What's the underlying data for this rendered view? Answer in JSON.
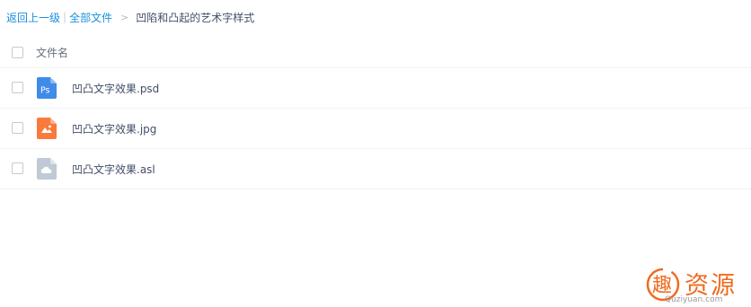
{
  "breadcrumb": {
    "back_label": "返回上一级",
    "separator": "|",
    "all_files_label": "全部文件",
    "arrow": ">",
    "current_folder": "凹陷和凸起的艺术字样式"
  },
  "table": {
    "header": {
      "filename_label": "文件名"
    },
    "files": [
      {
        "name": "凹凸文字效果.psd",
        "icon": "photoshop-file-icon",
        "icon_color": "#3f8be8"
      },
      {
        "name": "凹凸文字效果.jpg",
        "icon": "image-file-icon",
        "icon_color": "#f87a3c"
      },
      {
        "name": "凹凸文字效果.asl",
        "icon": "generic-file-icon",
        "icon_color": "#c0c9d6"
      }
    ]
  },
  "watermark": {
    "logo_char": "趣",
    "text": "资源",
    "subtext": "Quziyuan.com",
    "color": "#f06a1e"
  },
  "colors": {
    "link": "#1a8fde",
    "text": "#424e67",
    "divider": "#f1f2f4"
  }
}
